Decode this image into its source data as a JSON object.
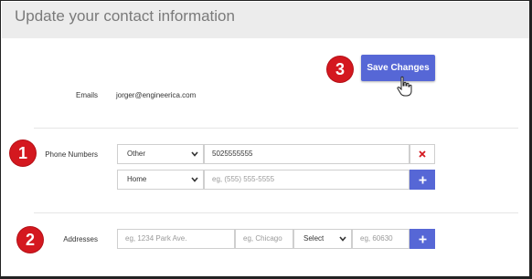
{
  "header": {
    "title": "Update your contact information"
  },
  "steps": {
    "one": "1",
    "two": "2",
    "three": "3"
  },
  "toolbar": {
    "save_label": "Save Changes"
  },
  "emails": {
    "label": "Emails",
    "value": "jorger@engineerica.com"
  },
  "phones": {
    "label": "Phone Numbers",
    "rows": [
      {
        "type": "Other",
        "number": "5025555555"
      },
      {
        "type": "Home",
        "placeholder": "eg, (555) 555-5555"
      }
    ]
  },
  "addresses": {
    "label": "Addresses",
    "street_placeholder": "eg, 1234 Park Ave.",
    "city_placeholder": "eg, Chicago",
    "state_selected": "Select",
    "zip_placeholder": "eg, 60630"
  },
  "colors": {
    "accent": "#5667d6",
    "step_badge": "#d4181f",
    "remove": "#d4181f"
  },
  "icons": {
    "remove": "close-icon",
    "add": "plus-icon",
    "dropdown": "chevron-down-icon",
    "cursor": "hand-pointer-icon"
  }
}
